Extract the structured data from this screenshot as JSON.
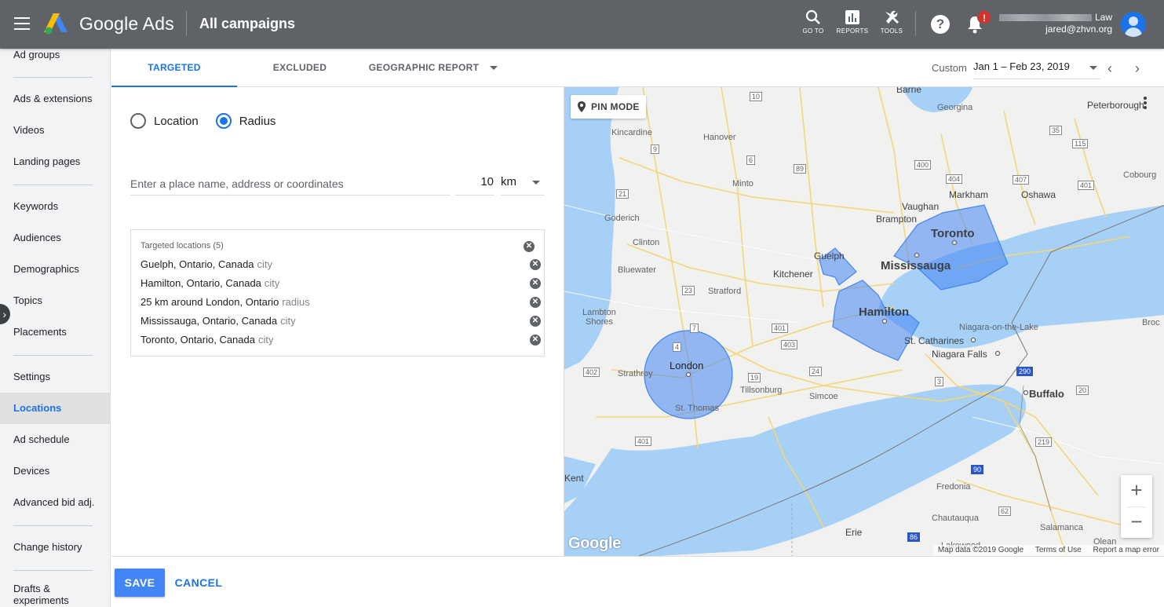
{
  "header": {
    "brand": "Google Ads",
    "page_title": "All campaigns",
    "tools": [
      {
        "label": "GO TO",
        "icon": "search-icon"
      },
      {
        "label": "REPORTS",
        "icon": "bar-chart-icon"
      },
      {
        "label": "TOOLS",
        "icon": "wrench-icon"
      }
    ],
    "notification_badge": "!",
    "account": {
      "name": "Law",
      "email": "jared@zhvn.org"
    }
  },
  "sidebar": {
    "items": [
      {
        "label": "Ad groups"
      },
      {
        "label": "Ads & extensions"
      },
      {
        "label": "Videos"
      },
      {
        "label": "Landing pages"
      },
      {
        "label": "Keywords"
      },
      {
        "label": "Audiences"
      },
      {
        "label": "Demographics"
      },
      {
        "label": "Topics"
      },
      {
        "label": "Placements"
      },
      {
        "label": "Settings"
      },
      {
        "label": "Locations",
        "active": true
      },
      {
        "label": "Ad schedule"
      },
      {
        "label": "Devices"
      },
      {
        "label": "Advanced bid adj."
      },
      {
        "label": "Change history"
      },
      {
        "label": "Drafts & experiments"
      }
    ]
  },
  "tabs": {
    "items": [
      {
        "label": "TARGETED",
        "active": true
      },
      {
        "label": "EXCLUDED"
      },
      {
        "label": "GEOGRAPHIC REPORT"
      }
    ],
    "date_prefix": "Custom",
    "date_range": "Jan 1 – Feb 23, 2019"
  },
  "targeting": {
    "mode_options": [
      {
        "label": "Location",
        "selected": false
      },
      {
        "label": "Radius",
        "selected": true
      }
    ],
    "place_placeholder": "Enter a place name, address or coordinates",
    "radius_value": "10",
    "radius_unit": "km",
    "targeted_header": "Targeted locations (5)",
    "locations": [
      {
        "name": "Guelph, Ontario, Canada",
        "type": "city"
      },
      {
        "name": "Hamilton, Ontario, Canada",
        "type": "city"
      },
      {
        "name": "25 km around London, Ontario",
        "type": "radius"
      },
      {
        "name": "Mississauga, Ontario, Canada",
        "type": "city"
      },
      {
        "name": "Toronto, Ontario, Canada",
        "type": "city"
      }
    ]
  },
  "map": {
    "pin_mode_label": "PIN MODE",
    "logo": "Google",
    "attribution": [
      "Map data ©2019 Google",
      "Terms of Use",
      "Report a map error"
    ],
    "labels": {
      "barrie": "Barrie",
      "georgina": "Georgina",
      "peterborough": "Peterborough",
      "kincardine": "Kincardine",
      "hanover": "Hanover",
      "minto": "Minto",
      "markham": "Markham",
      "vaughan": "Vaughan",
      "oshawa": "Oshawa",
      "cobourg": "Cobourg",
      "goderich": "Goderich",
      "brampton": "Brampton",
      "toronto": "Toronto",
      "clinton": "Clinton",
      "guelph": "Guelph",
      "mississauga": "Mississauga",
      "kitchener": "Kitchener",
      "bluewater": "Bluewater",
      "stratford": "Stratford",
      "lambton": "Lambton",
      "shores": "Shores",
      "hamilton": "Hamilton",
      "niagara_lake": "Niagara-on-the-Lake",
      "broc": "Broc",
      "st_catharines": "St. Catharines",
      "niagara_falls": "Niagara Falls",
      "london": "London",
      "strathroy": "Strathroy",
      "tillsonburg": "Tillsonburg",
      "simcoe": "Simcoe",
      "st_thomas": "St. Thomas",
      "buffalo": "Buffalo",
      "kent": "Kent",
      "fredonia": "Fredonia",
      "chautauqua": "Chautauqua",
      "salamanca": "Salamanca",
      "erie": "Erie",
      "lakewood": "Lakewood",
      "olean": "Olean"
    },
    "highway_shields": [
      "10",
      "9",
      "6",
      "89",
      "400",
      "404",
      "407",
      "401",
      "115",
      "35",
      "21",
      "23",
      "7",
      "4",
      "401",
      "403",
      "19",
      "24",
      "3",
      "402",
      "401",
      "290",
      "20",
      "219",
      "90",
      "62",
      "86"
    ]
  },
  "footer": {
    "save_label": "SAVE",
    "cancel_label": "CANCEL"
  },
  "colors": {
    "header_bg": "#5f6368",
    "accent": "#1a73e8",
    "save_button": "#4285f4",
    "target_fill": "#4285f4",
    "water": "#a7d0f7"
  }
}
